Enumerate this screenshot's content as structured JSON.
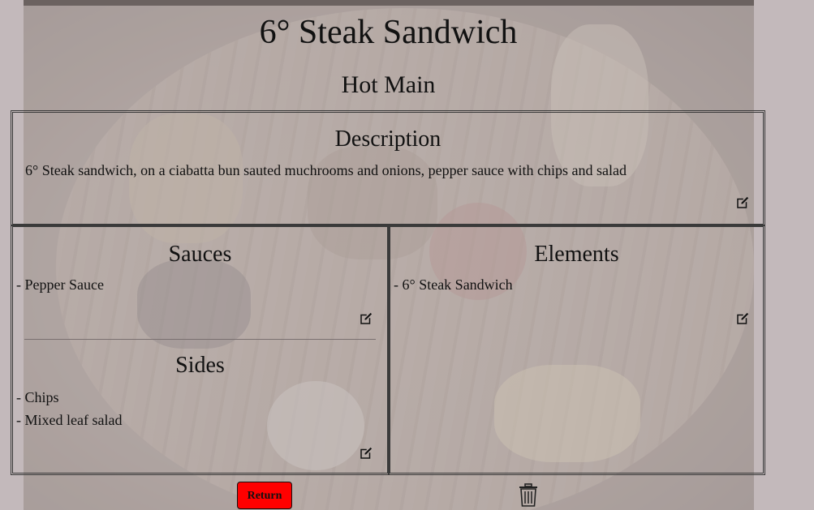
{
  "dish": {
    "title": "6° Steak Sandwich",
    "category": "Hot Main"
  },
  "description": {
    "heading": "Description",
    "text": "6° Steak sandwich, on a ciabatta bun sauted muchrooms and onions, pepper sauce with chips and salad",
    "edit_icon": "edit-icon"
  },
  "sauces": {
    "heading": "Sauces",
    "items": [
      "- Pepper Sauce"
    ],
    "edit_icon": "edit-icon"
  },
  "sides": {
    "heading": "Sides",
    "items": [
      "- Chips",
      "- Mixed leaf salad"
    ],
    "edit_icon": "edit-icon"
  },
  "elements": {
    "heading": "Elements",
    "items": [
      "- 6° Steak Sandwich"
    ],
    "edit_icon": "edit-icon"
  },
  "actions": {
    "return_label": "Return",
    "delete_icon": "trash-icon"
  },
  "colors": {
    "return_button": "#ff0000",
    "page_background": "#c3b9bb"
  }
}
